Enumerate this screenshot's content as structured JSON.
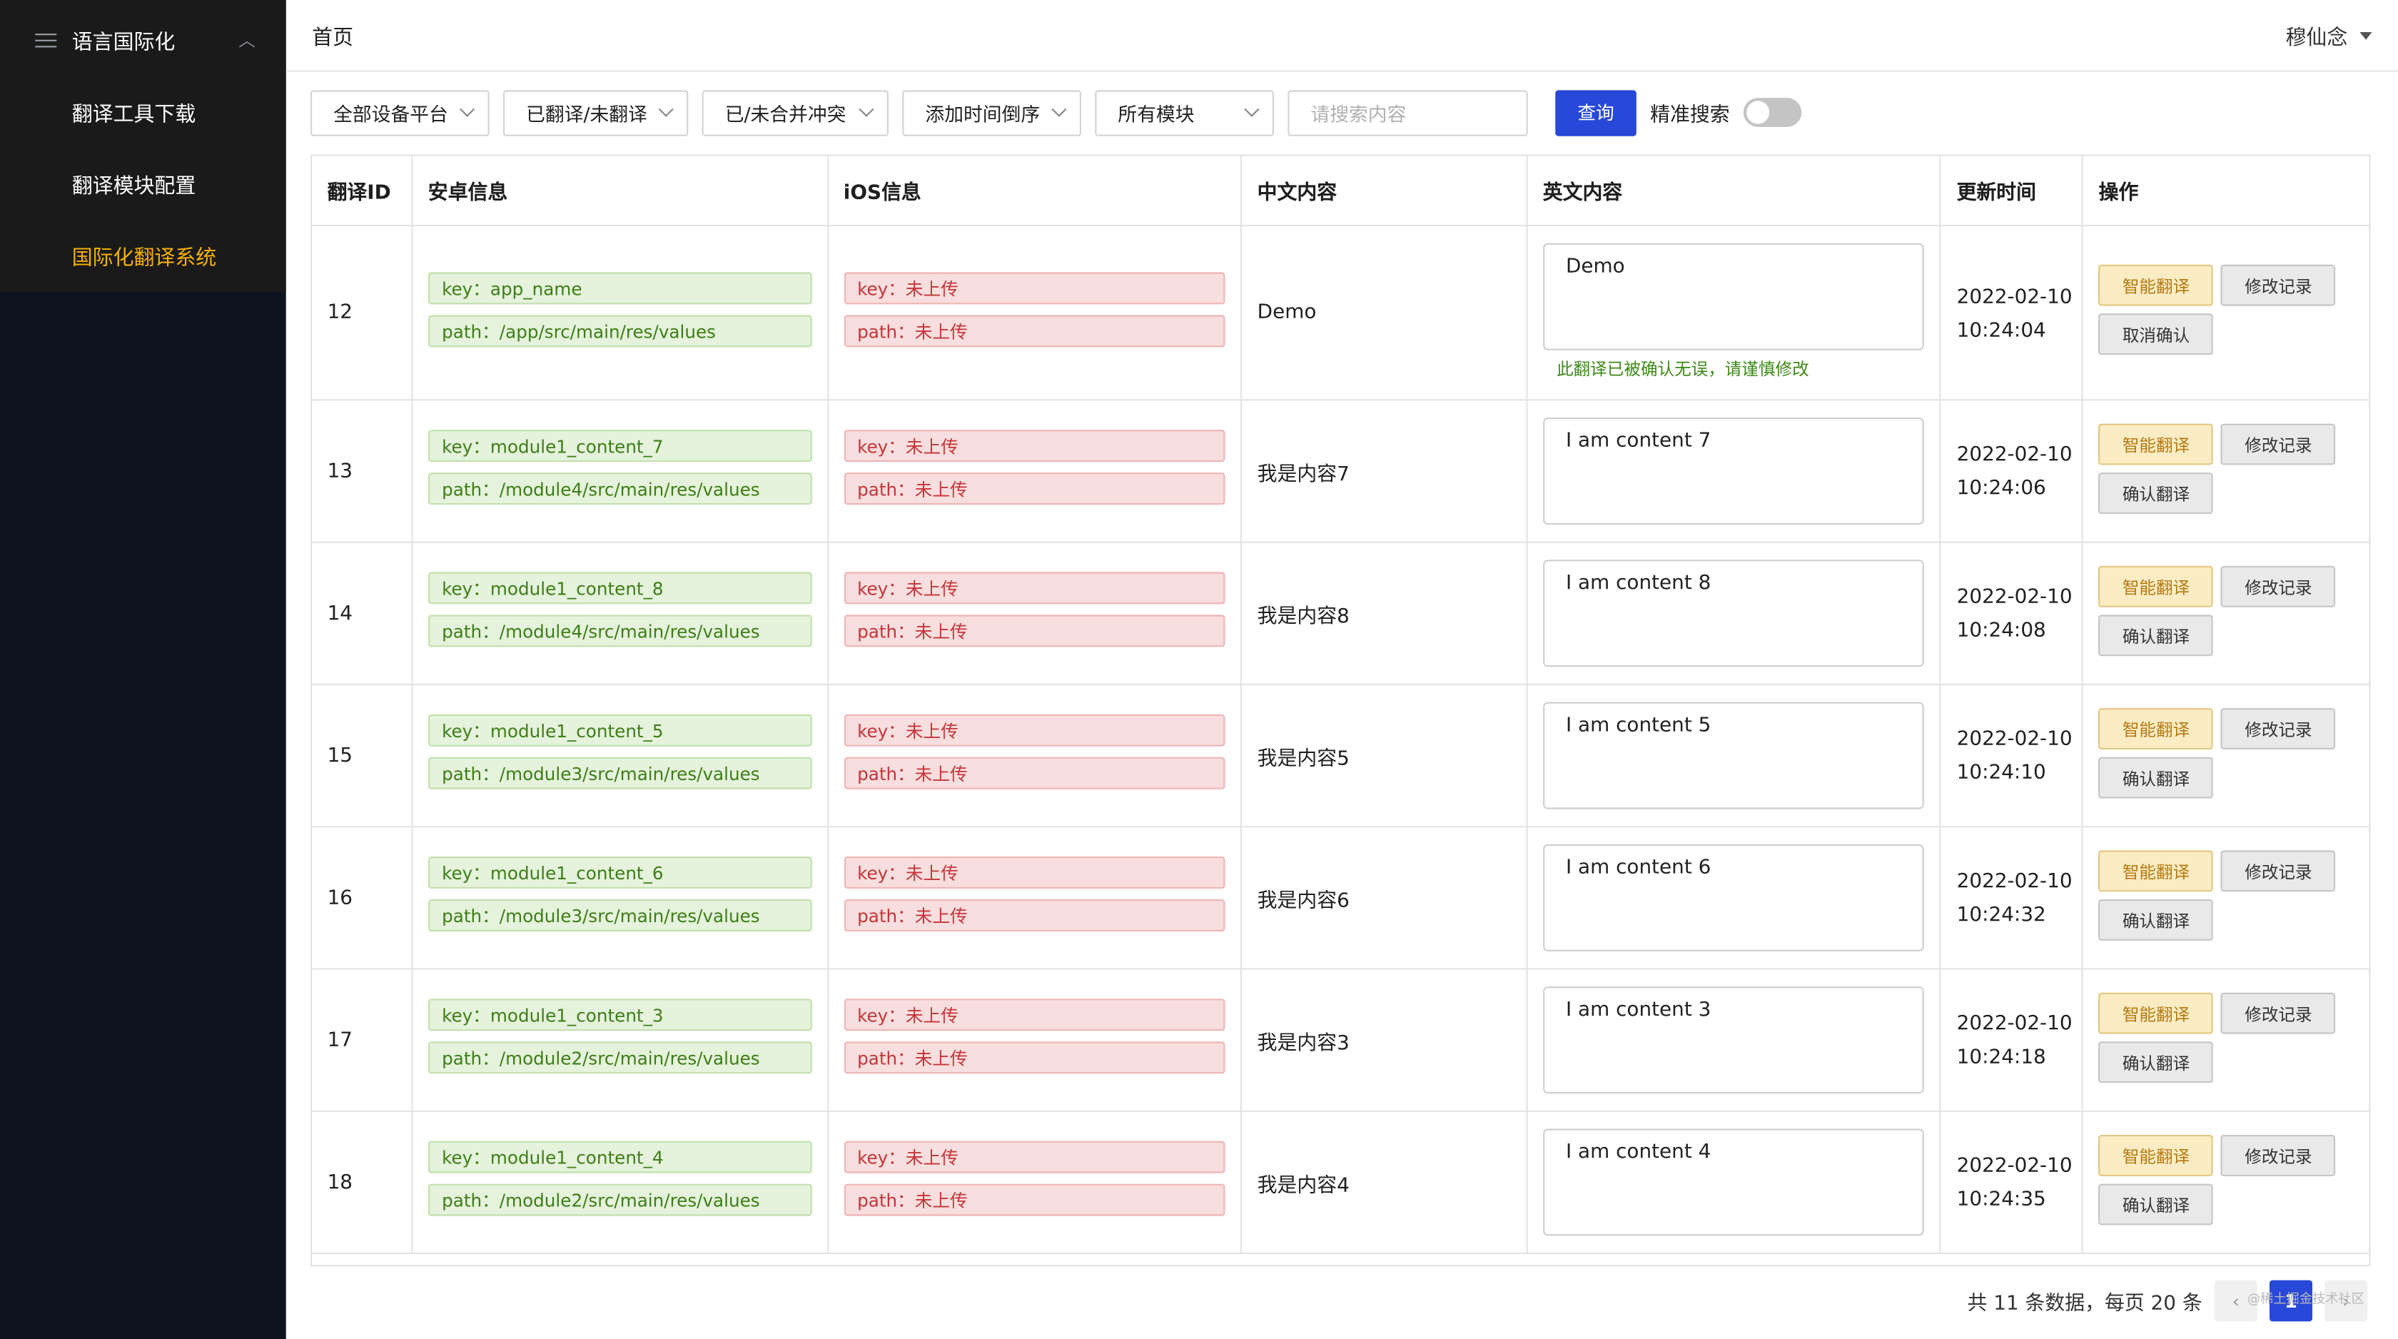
{
  "sidebar": {
    "group_label": "语言国际化",
    "items": [
      {
        "label": "翻译工具下载"
      },
      {
        "label": "翻译模块配置"
      },
      {
        "label": "国际化翻译系统",
        "active": true
      }
    ]
  },
  "header": {
    "title": "首页",
    "user": "穆仙念"
  },
  "toolbar": {
    "filters": [
      "全部设备平台",
      "已翻译/未翻译",
      "已/未合并冲突",
      "添加时间倒序",
      "所有模块"
    ],
    "search_placeholder": "请搜索内容",
    "search_button": "查询",
    "exact_label": "精准搜索",
    "exact_on": false
  },
  "table": {
    "columns": [
      "翻译ID",
      "安卓信息",
      "iOS信息",
      "中文内容",
      "英文内容",
      "更新时间",
      "操作"
    ],
    "rows": [
      {
        "id": "12",
        "android_key": "key：app_name",
        "android_path": "path：/app/src/main/res/values",
        "ios_key": "key：未上传",
        "ios_path": "path：未上传",
        "zh": "Demo",
        "en": "Demo",
        "note": "此翻译已被确认无误，请谨慎修改",
        "date": "2022-02-10",
        "time": "10:24:04",
        "btn_smart": "智能翻译",
        "btn_log": "修改记录",
        "btn_confirm": "取消确认"
      },
      {
        "id": "13",
        "android_key": "key：module1_content_7",
        "android_path": "path：/module4/src/main/res/values",
        "ios_key": "key：未上传",
        "ios_path": "path：未上传",
        "zh": "我是内容7",
        "en": "I am content 7",
        "note": "",
        "date": "2022-02-10",
        "time": "10:24:06",
        "btn_smart": "智能翻译",
        "btn_log": "修改记录",
        "btn_confirm": "确认翻译"
      },
      {
        "id": "14",
        "android_key": "key：module1_content_8",
        "android_path": "path：/module4/src/main/res/values",
        "ios_key": "key：未上传",
        "ios_path": "path：未上传",
        "zh": "我是内容8",
        "en": "I am content 8",
        "note": "",
        "date": "2022-02-10",
        "time": "10:24:08",
        "btn_smart": "智能翻译",
        "btn_log": "修改记录",
        "btn_confirm": "确认翻译"
      },
      {
        "id": "15",
        "android_key": "key：module1_content_5",
        "android_path": "path：/module3/src/main/res/values",
        "ios_key": "key：未上传",
        "ios_path": "path：未上传",
        "zh": "我是内容5",
        "en": "I am content 5",
        "note": "",
        "date": "2022-02-10",
        "time": "10:24:10",
        "btn_smart": "智能翻译",
        "btn_log": "修改记录",
        "btn_confirm": "确认翻译"
      },
      {
        "id": "16",
        "android_key": "key：module1_content_6",
        "android_path": "path：/module3/src/main/res/values",
        "ios_key": "key：未上传",
        "ios_path": "path：未上传",
        "zh": "我是内容6",
        "en": "I am content 6",
        "note": "",
        "date": "2022-02-10",
        "time": "10:24:32",
        "btn_smart": "智能翻译",
        "btn_log": "修改记录",
        "btn_confirm": "确认翻译"
      },
      {
        "id": "17",
        "android_key": "key：module1_content_3",
        "android_path": "path：/module2/src/main/res/values",
        "ios_key": "key：未上传",
        "ios_path": "path：未上传",
        "zh": "我是内容3",
        "en": "I am content 3",
        "note": "",
        "date": "2022-02-10",
        "time": "10:24:18",
        "btn_smart": "智能翻译",
        "btn_log": "修改记录",
        "btn_confirm": "确认翻译"
      },
      {
        "id": "18",
        "android_key": "key：module1_content_4",
        "android_path": "path：/module2/src/main/res/values",
        "ios_key": "key：未上传",
        "ios_path": "path：未上传",
        "zh": "我是内容4",
        "en": "I am content 4",
        "note": "",
        "date": "2022-02-10",
        "time": "10:24:35",
        "btn_smart": "智能翻译",
        "btn_log": "修改记录",
        "btn_confirm": "确认翻译"
      }
    ]
  },
  "pagination": {
    "summary": "共 11 条数据，每页 20 条",
    "current_page": "1",
    "prev_icon": "‹",
    "next_icon": "›"
  },
  "watermark": "@稀土掘金技术社区",
  "colors": {
    "primary": "#2748d8",
    "active_menu": "#f5b000",
    "sidebar_bg": "#0e1320",
    "tag_green": "#3d7f16",
    "tag_red": "#c6353a"
  }
}
